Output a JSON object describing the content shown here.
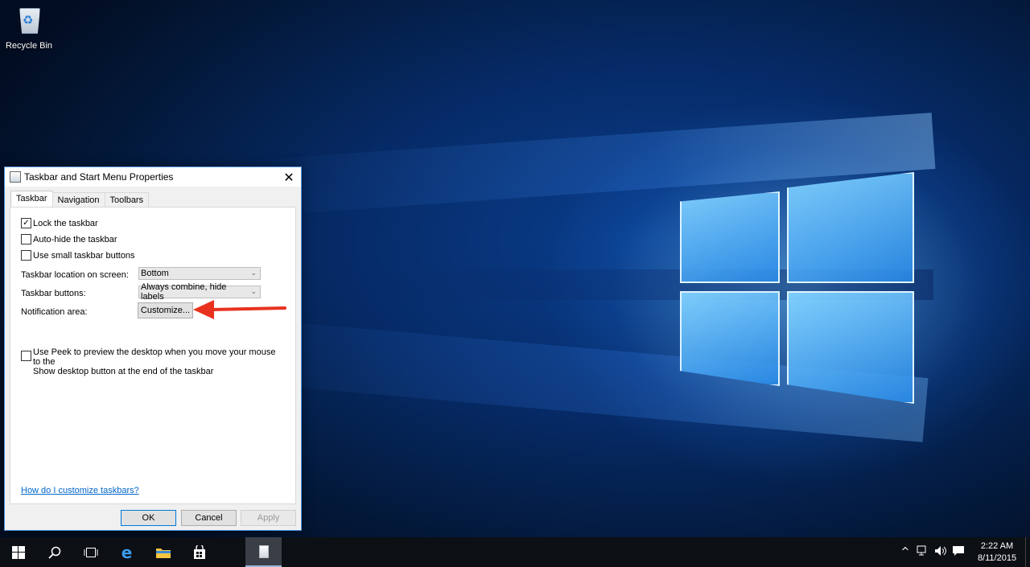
{
  "desktop": {
    "icons": [
      {
        "label": "Recycle Bin",
        "icon": "recycle-bin-icon"
      }
    ]
  },
  "dialog": {
    "title": "Taskbar and Start Menu Properties",
    "tabs": [
      {
        "label": "Taskbar",
        "active": true
      },
      {
        "label": "Navigation",
        "active": false
      },
      {
        "label": "Toolbars",
        "active": false
      }
    ],
    "checkboxes": [
      {
        "label": "Lock the taskbar",
        "checked": true
      },
      {
        "label": "Auto-hide the taskbar",
        "checked": false
      },
      {
        "label": "Use small taskbar buttons",
        "checked": false
      }
    ],
    "location_label": "Taskbar location on screen:",
    "location_value": "Bottom",
    "buttons_label": "Taskbar buttons:",
    "buttons_value": "Always combine, hide labels",
    "notification_label": "Notification area:",
    "customize_label": "Customize...",
    "peek_line1": "Use Peek to preview the desktop when you move your mouse to the",
    "peek_line2": "Show desktop button at the end of the taskbar",
    "peek_checked": false,
    "help_link": "How do I customize taskbars?",
    "ok_label": "OK",
    "cancel_label": "Cancel",
    "apply_label": "Apply"
  },
  "annotation": {
    "arrow_color": "#e8321e"
  },
  "taskbar": {
    "buttons": [
      "windows-start-icon",
      "search-icon",
      "task-view-icon",
      "edge-browser-icon",
      "file-explorer-icon",
      "store-icon"
    ],
    "active_app_icon": "taskbar-properties-icon",
    "clock_time": "2:22 AM",
    "clock_date": "8/11/2015"
  },
  "colors": {
    "accent": "#0078d7",
    "taskbar_bg": "#0c0f14",
    "link": "#0066cc"
  }
}
